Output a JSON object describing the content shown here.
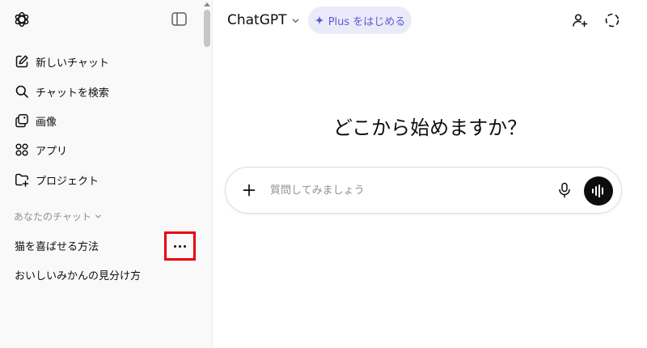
{
  "sidebar": {
    "items": [
      {
        "label": "新しいチャット"
      },
      {
        "label": "チャットを検索"
      },
      {
        "label": "画像"
      },
      {
        "label": "アプリ"
      },
      {
        "label": "プロジェクト"
      }
    ],
    "section_label": "あなたのチャット",
    "chats": [
      {
        "title": "猫を喜ばせる方法"
      },
      {
        "title": "おいしいみかんの見分け方"
      }
    ]
  },
  "header": {
    "model_name": "ChatGPT",
    "plus_label": "Plus をはじめる"
  },
  "main": {
    "headline": "どこから始めますか？",
    "composer": {
      "placeholder": "質問してみましょう",
      "value": ""
    }
  },
  "colors": {
    "accent": "#5b5bd6",
    "plus_bg": "#ebeaf8",
    "highlight": "#e60012",
    "sidebar_bg": "#f9f9f9"
  },
  "icons": [
    "openai-logo-icon",
    "sidebar-toggle-icon",
    "edit-icon",
    "search-icon",
    "images-icon",
    "apps-icon",
    "project-folder-icon",
    "chevron-down-icon",
    "more-dots-icon",
    "sparkle-icon",
    "add-user-icon",
    "temporary-chat-icon",
    "plus-icon",
    "microphone-icon",
    "voice-wave-icon"
  ]
}
